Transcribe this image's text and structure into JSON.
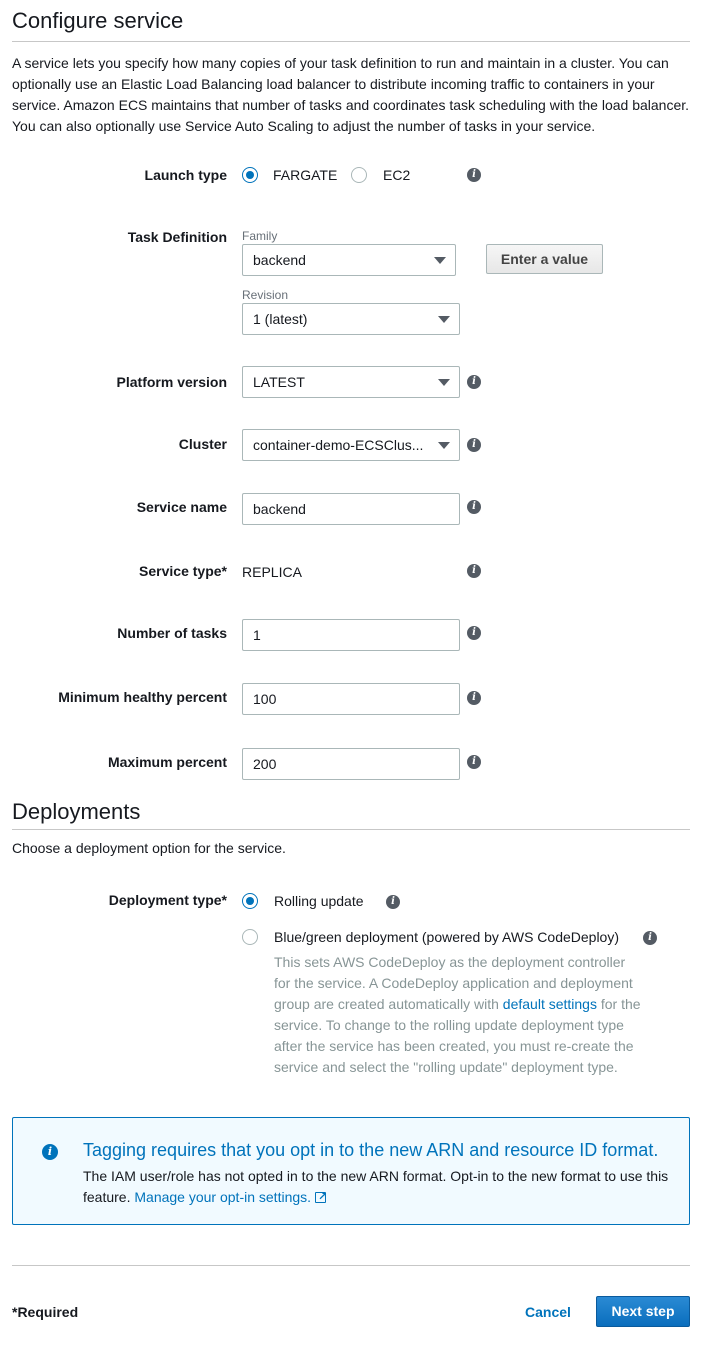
{
  "configure": {
    "title": "Configure service",
    "description": "A service lets you specify how many copies of your task definition to run and maintain in a cluster. You can optionally use an Elastic Load Balancing load balancer to distribute incoming traffic to containers in your service. Amazon ECS maintains that number of tasks and coordinates task scheduling with the load balancer. You can also optionally use Service Auto Scaling to adjust the number of tasks in your service."
  },
  "launch_type": {
    "label": "Launch type",
    "options": [
      "FARGATE",
      "EC2"
    ],
    "selected": "FARGATE"
  },
  "task_definition": {
    "label": "Task Definition",
    "family_label": "Family",
    "family_value": "backend",
    "enter_value_button": "Enter a value",
    "revision_label": "Revision",
    "revision_value": "1 (latest)"
  },
  "platform_version": {
    "label": "Platform version",
    "value": "LATEST"
  },
  "cluster": {
    "label": "Cluster",
    "value": "container-demo-ECSClus..."
  },
  "service_name": {
    "label": "Service name",
    "value": "backend"
  },
  "service_type": {
    "label": "Service type*",
    "value": "REPLICA"
  },
  "number_of_tasks": {
    "label": "Number of tasks",
    "value": "1"
  },
  "min_healthy": {
    "label": "Minimum healthy percent",
    "value": "100"
  },
  "max_percent": {
    "label": "Maximum percent",
    "value": "200"
  },
  "deployments": {
    "title": "Deployments",
    "description": "Choose a deployment option for the service.",
    "type_label": "Deployment type*",
    "rolling_label": "Rolling update",
    "bluegreen_label": "Blue/green deployment (powered by AWS CodeDeploy)",
    "bluegreen_help_1": "This sets AWS CodeDeploy as the deployment controller for the service. A CodeDeploy application and deployment group are created automatically with",
    "bluegreen_help_link": "default settings",
    "bluegreen_help_2": "for the service. To change to the rolling update deployment type after the service has been created, you must re-create the service and select the \"rolling update\" deployment type.",
    "selected": "Rolling update"
  },
  "alert": {
    "title": "Tagging requires that you opt in to the new ARN and resource ID format.",
    "body": "The IAM user/role has not opted in to the new ARN format. Opt-in to the new format to use this feature.",
    "link": "Manage your opt-in settings."
  },
  "footer": {
    "required_note": "*Required",
    "cancel": "Cancel",
    "next": "Next step"
  },
  "colors": {
    "accent": "#0073bb",
    "primary_button": "#0a6ebd",
    "alert_bg": "#f1faff"
  }
}
